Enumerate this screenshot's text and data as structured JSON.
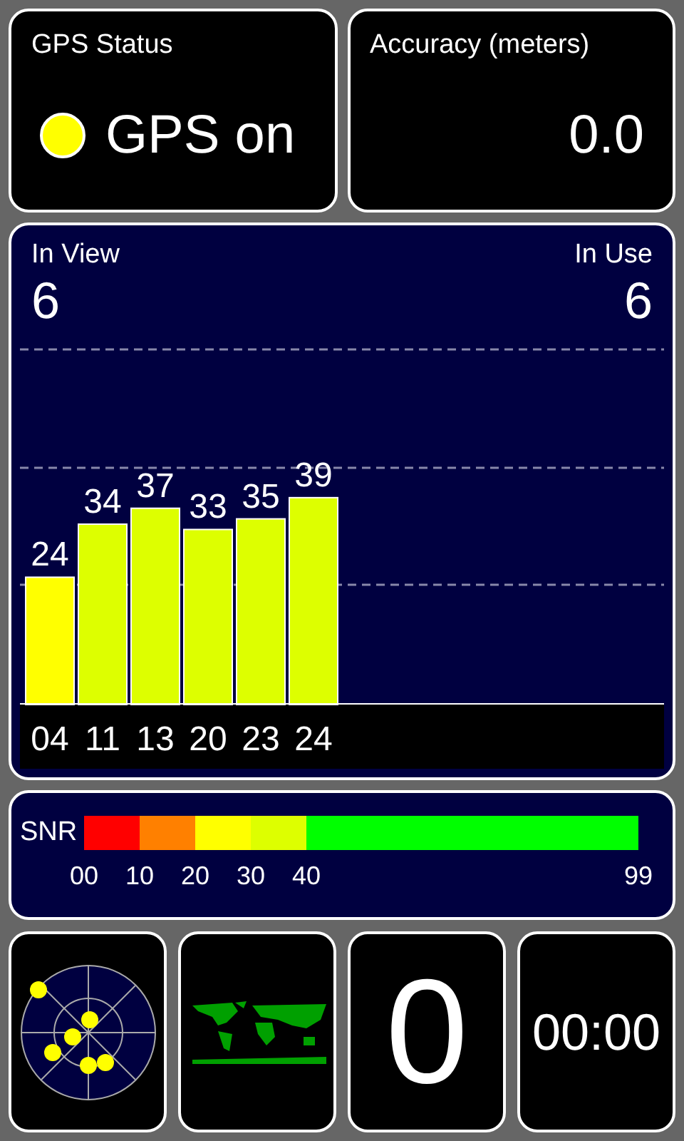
{
  "status": {
    "title": "GPS Status",
    "value": "GPS on",
    "color": "#ffff00"
  },
  "accuracy": {
    "title": "Accuracy (meters)",
    "value": "0.0"
  },
  "satellites": {
    "in_view_label": "In View",
    "in_view": "6",
    "in_use_label": "In Use",
    "in_use": "6",
    "chart_data": {
      "type": "bar",
      "categories": [
        "04",
        "11",
        "13",
        "20",
        "23",
        "24"
      ],
      "values": [
        24,
        34,
        37,
        33,
        35,
        39
      ],
      "data_labels": true
    }
  },
  "snr": {
    "label": "SNR",
    "segments": [
      {
        "color": "#ff0000"
      },
      {
        "color": "#ff8000"
      },
      {
        "color": "#ffff00"
      },
      {
        "color": "#ddff00"
      },
      {
        "color": "#00ff00"
      }
    ],
    "ticks": [
      "00",
      "10",
      "20",
      "30",
      "40",
      "99"
    ]
  },
  "tiles": {
    "count": "0",
    "timer": "00:00"
  }
}
